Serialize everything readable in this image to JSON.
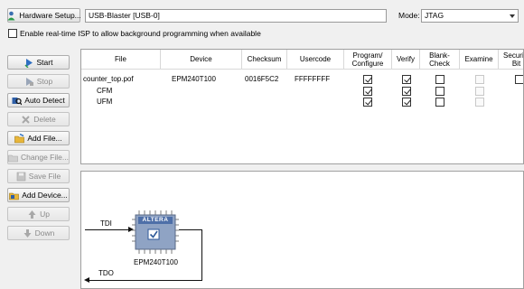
{
  "toolbar": {
    "hardware_setup_label": "Hardware Setup...",
    "hardware_value": "USB-Blaster [USB-0]",
    "mode_label": "Mode:",
    "mode_value": "JTAG",
    "realtime_isp_label": "Enable real-time ISP to allow background programming when available",
    "realtime_isp_checked": false
  },
  "side_buttons": [
    {
      "label": "Start",
      "enabled": true,
      "icon": "start-icon"
    },
    {
      "label": "Stop",
      "enabled": false,
      "icon": "stop-icon"
    },
    {
      "label": "Auto Detect",
      "enabled": true,
      "icon": "auto-detect-icon"
    },
    {
      "label": "Delete",
      "enabled": false,
      "icon": "delete-icon"
    },
    {
      "label": "Add File...",
      "enabled": true,
      "icon": "add-file-icon"
    },
    {
      "label": "Change File...",
      "enabled": false,
      "icon": "change-file-icon"
    },
    {
      "label": "Save File",
      "enabled": false,
      "icon": "save-file-icon"
    },
    {
      "label": "Add Device...",
      "enabled": true,
      "icon": "add-device-icon"
    },
    {
      "label": "Up",
      "enabled": false,
      "icon": "up-icon"
    },
    {
      "label": "Down",
      "enabled": false,
      "icon": "down-icon"
    }
  ],
  "table": {
    "columns": [
      "File",
      "Device",
      "Checksum",
      "Usercode",
      "Program/ Configure",
      "Verify",
      "Blank- Check",
      "Examine",
      "Security Bit"
    ],
    "rows": [
      {
        "file": "counter_top.pof",
        "device": "EPM240T100",
        "checksum": "0016F5C2",
        "usercode": "FFFFFFFF",
        "checks": [
          true,
          true,
          false,
          false,
          false
        ],
        "disabled": [
          false,
          false,
          false,
          true,
          false
        ]
      },
      {
        "file": "CFM",
        "device": "",
        "checksum": "",
        "usercode": "",
        "checks": [
          true,
          true,
          false,
          false,
          null
        ],
        "disabled": [
          false,
          false,
          false,
          true,
          true
        ]
      },
      {
        "file": "UFM",
        "device": "",
        "checksum": "",
        "usercode": "",
        "checks": [
          true,
          true,
          false,
          false,
          null
        ],
        "disabled": [
          false,
          false,
          false,
          true,
          true
        ]
      }
    ]
  },
  "chain": {
    "tdi_label": "TDI",
    "tdo_label": "TDO",
    "chip_logo": "ALTERA",
    "device_name": "EPM240T100"
  },
  "colors": {
    "chip_body": "#8fa3c4",
    "chip_logo_bg": "#4e6fa8",
    "window_bg": "#f0f0f0"
  }
}
